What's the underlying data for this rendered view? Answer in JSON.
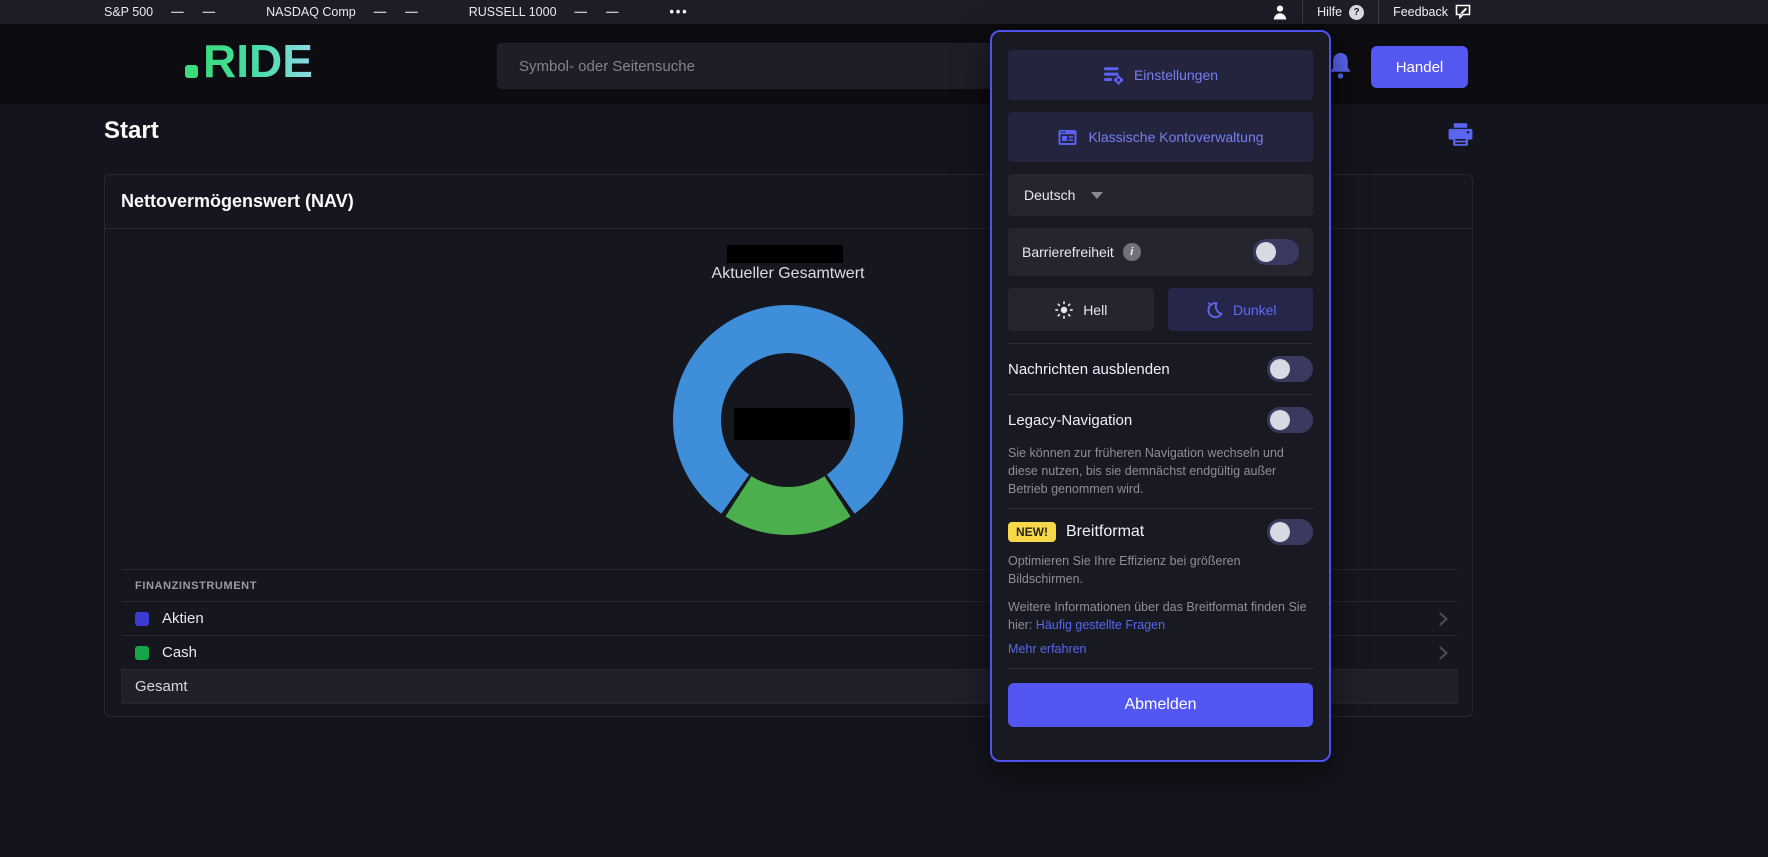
{
  "colors": {
    "accent_indigo": "#5457f0",
    "panel_border": "#4f53ee",
    "link_blue": "#5468f0",
    "logo_gradient_start": "#3bdc7d",
    "logo_gradient_end": "#8fd8e8",
    "donut_blue": "#3e8ed9",
    "donut_green": "#4caf4e",
    "new_badge_yellow": "#f6d848"
  },
  "ticker": {
    "indices": [
      {
        "name": "S&P 500",
        "dash1": "—",
        "dash2": "—"
      },
      {
        "name": "NASDAQ Comp",
        "dash1": "—",
        "dash2": "—"
      },
      {
        "name": "RUSSELL 1000",
        "dash1": "—",
        "dash2": "—"
      }
    ],
    "more": "•••",
    "help": "Hilfe",
    "help_badge": "?",
    "feedback": "Feedback"
  },
  "header": {
    "logo": "RIDE",
    "search_placeholder": "Symbol- oder Seitensuche",
    "trade_button": "Handel"
  },
  "page": {
    "title": "Start"
  },
  "nav_card": {
    "title": "Nettovermögenswert (NAV)",
    "chart_center_label": "Aktueller Gesamtwert",
    "table": {
      "column_header": "FINANZINSTRUMENT",
      "rows": [
        {
          "label": "Aktien",
          "color": "#3b3bd3"
        },
        {
          "label": "Cash",
          "color": "#17a54a"
        }
      ],
      "total_row": "Gesamt"
    }
  },
  "chart_data": {
    "type": "pie",
    "title": "Nettovermögenswert (NAV)",
    "center_label": "Aktueller Gesamtwert",
    "segments": [
      {
        "label": "Aktien",
        "percent": 81,
        "color": "#3e8ed9"
      },
      {
        "label": "Cash",
        "percent": 19,
        "color": "#4caf4e"
      }
    ]
  },
  "settings_panel": {
    "settings_button": "Einstellungen",
    "classic_button": "Klassische Kontoverwaltung",
    "language": {
      "selected": "Deutsch"
    },
    "accessibility": {
      "label": "Barrierefreiheit",
      "enabled": false
    },
    "theme": {
      "light": "Hell",
      "dark": "Dunkel",
      "selected": "Dunkel"
    },
    "hide_news": {
      "label": "Nachrichten ausblenden",
      "enabled": false
    },
    "legacy_nav": {
      "label": "Legacy-Navigation",
      "enabled": false,
      "description": "Sie können zur früheren Navigation wechseln und diese nutzen, bis sie demnächst endgültig außer Betrieb genommen wird."
    },
    "wide_format": {
      "badge": "NEW!",
      "label": "Breitformat",
      "enabled": false,
      "description": "Optimieren Sie Ihre Effizienz bei größeren Bildschirmen.",
      "info_prefix": "Weitere Informationen über das Breitformat finden Sie hier: ",
      "faq_link": "Häufig gestellte Fragen",
      "learn_more": "Mehr erfahren"
    },
    "logout_button": "Abmelden"
  }
}
